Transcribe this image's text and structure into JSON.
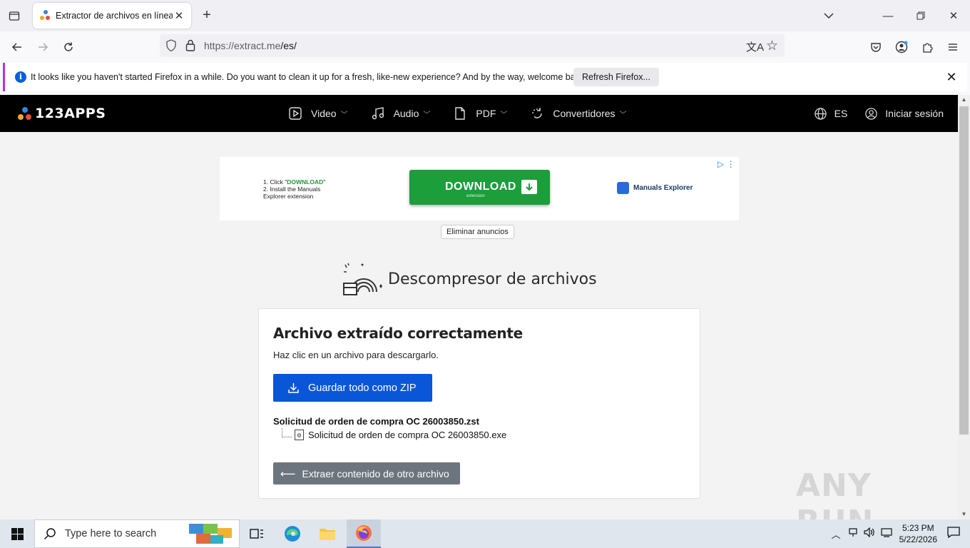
{
  "browser": {
    "tab_title": "Extractor de archivos en línea",
    "url_host": "https://extract.me",
    "url_path": "/es/",
    "notification_text": "It looks like you haven't started Firefox in a while. Do you want to clean it up for a fresh, like-new experience? And by the way, welcome back!",
    "notification_button": "Refresh Firefox..."
  },
  "site": {
    "logo": "123APPS",
    "nav": [
      {
        "label": "Video"
      },
      {
        "label": "Audio"
      },
      {
        "label": "PDF"
      },
      {
        "label": "Convertidores"
      }
    ],
    "language": "ES",
    "login": "Iniciar sesión"
  },
  "ad": {
    "step1_prefix": "1. Click \"",
    "step1_word": "DOWNLOAD",
    "step1_suffix": "\"",
    "step2": "2. Install the Manuals",
    "step2b": "Explorer extension",
    "button": "DOWNLOAD",
    "button_sub": "extension",
    "brand": "Manuals Explorer",
    "remove_ads": "Eliminar anuncios"
  },
  "tool": {
    "title": "Descompresor de archivos",
    "card_title": "Archivo extraído correctamente",
    "card_subtitle": "Haz clic en un archivo para descargarlo.",
    "zip_button": "Guardar todo como ZIP",
    "archive_name": "Solicitud de orden de compra OC 26003850.zst",
    "extracted_file": "Solicitud de orden de compra OC 26003850.exe",
    "other_button": "Extraer contenido de otro archivo"
  },
  "watermark": "ANY RUN",
  "taskbar": {
    "search_placeholder": "Type here to search",
    "time": "5:23 PM",
    "date": "5/22/2026"
  },
  "colors": {
    "primary_button": "#0a56d8",
    "secondary_button": "#6c757d",
    "site_header": "#000000",
    "ad_green": "#1c9e3b"
  }
}
